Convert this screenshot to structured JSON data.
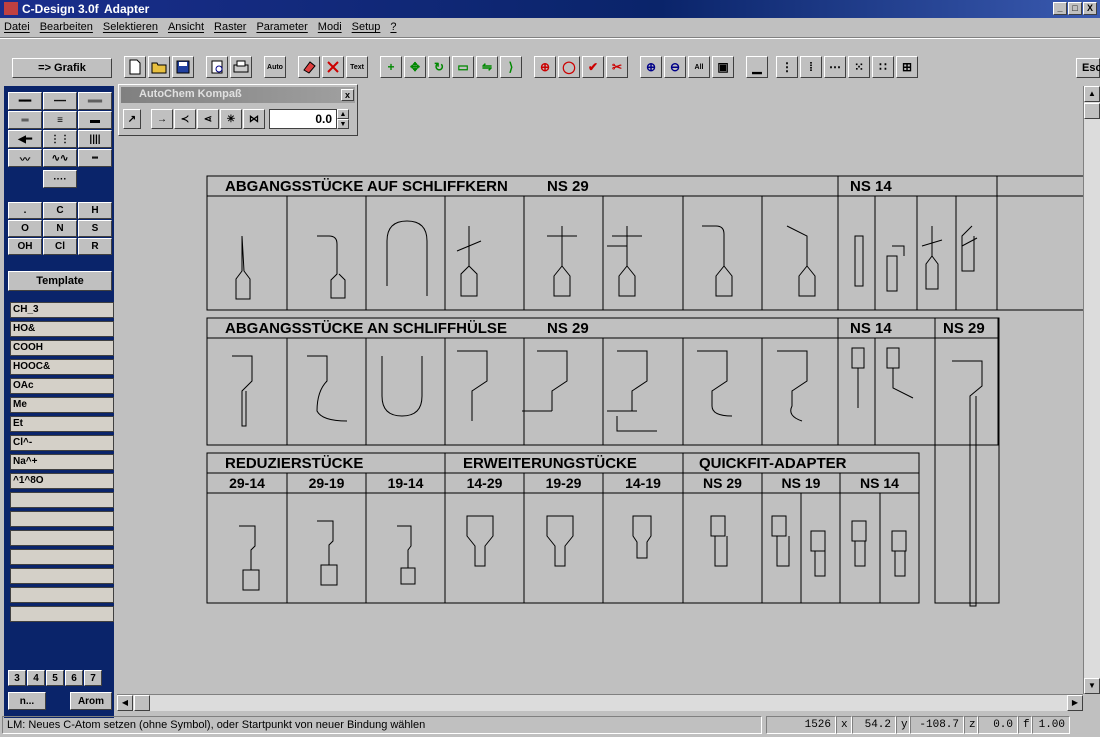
{
  "window": {
    "app_title": "C-Design 3.0f",
    "doc_title": "Adapter",
    "min": "_",
    "max": "□",
    "close": "X"
  },
  "menu": [
    "Datei",
    "Bearbeiten",
    "Selektieren",
    "Ansicht",
    "Raster",
    "Parameter",
    "Modi",
    "Setup",
    "?"
  ],
  "toolbar": {
    "grafik_label": "=> Grafik",
    "esc_label": "Esc",
    "text_label": "Text",
    "auto_label": "Auto"
  },
  "palette": {
    "title": "AutoChem Kompaß",
    "value": "0.0",
    "close": "x"
  },
  "atoms": {
    "row1": [
      ".",
      "C",
      "H"
    ],
    "row2": [
      "O",
      "N",
      "S"
    ],
    "row3": [
      "OH",
      "Cl",
      "R"
    ]
  },
  "template_label": "Template",
  "templates": [
    "CH_3",
    "HO&",
    "COOH",
    "HOOC&",
    "OAc",
    "Me",
    "Et",
    "Cl^-",
    "Na^+",
    "^1^8O"
  ],
  "rings": [
    "3",
    "4",
    "5",
    "6",
    "7"
  ],
  "ring_more": "n...",
  "arom_label": "Arom",
  "status": {
    "message": "LM: Neues C-Atom setzen (ohne Symbol), oder Startpunkt von neuer Bindung wählen",
    "count": "1526",
    "x_label": "x",
    "x_value": "54.2",
    "y_label": "y",
    "y_value": "-108.7",
    "z_label": "z",
    "z_value": "0.0",
    "f_label": "f",
    "f_value": "1.00"
  },
  "drawing": {
    "s1_title": "ABGANGSSTÜCKE AUF SCHLIFFKERN",
    "s1_ns": "NS 29",
    "s1_ns14": "NS 14",
    "s2_title": "ABGANGSSTÜCKE AN SCHLIFFHÜLSE",
    "s2_ns": "NS 29",
    "s2_ns14": "NS 14",
    "s2_ns29b": "NS 29",
    "s3_red": "REDUZIERSTÜCKE",
    "s3_erw": "ERWEITERUNGSTÜCKE",
    "s3_quick": "QUICKFIT-ADAPTER",
    "s3_sub": [
      "29-14",
      "29-19",
      "19-14",
      "14-29",
      "19-29",
      "14-19",
      "NS 29",
      "NS 19",
      "NS 14"
    ]
  }
}
